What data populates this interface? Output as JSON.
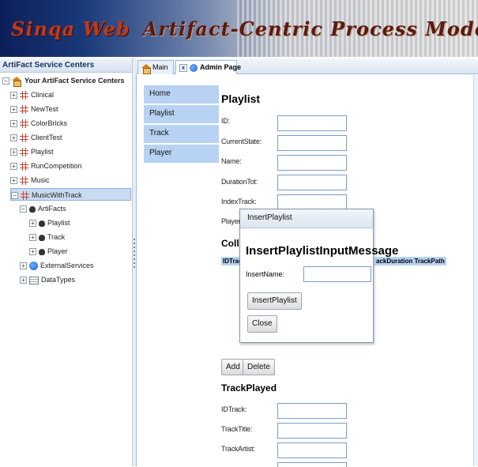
{
  "banner": {
    "title_left": "Sinqa Web",
    "title_right": "Artifact-Centric Process Modeling"
  },
  "sidebar": {
    "header": "ArtiFact Service Centers",
    "root": "Your ArtiFact Service Centers",
    "items": [
      "Clinical",
      "NewTest",
      "ColorBricks",
      "ClientTest",
      "Playlist",
      "RunCompetition",
      "Music",
      "MusicWithTrack"
    ],
    "artifacts": "ArtiFacts",
    "artifact_items": [
      "Playlist",
      "Track",
      "Player"
    ],
    "external": "ExternalServices",
    "datatypes": "DataTypes",
    "expand_plus": "+",
    "expand_minus": "−"
  },
  "tabs": {
    "main": "Main",
    "admin": "Admin Page",
    "close_x": "x"
  },
  "menu": [
    "Home",
    "Playlist",
    "Track",
    "Player"
  ],
  "playlist": {
    "title": "Playlist",
    "fields": [
      "ID:",
      "CurrentState:",
      "Name:",
      "DurationTot:",
      "IndexTrack:",
      "PlayerID"
    ],
    "collection_title": "Collec",
    "col_left": "IDTrack",
    "col_right": "ackDuration TrackPath",
    "add": "Add",
    "delete": "Delete"
  },
  "trackplayed": {
    "title": "TrackPlayed",
    "fields": [
      "IDTrack:",
      "TrackTitle:",
      "TrackArtist:"
    ]
  },
  "dialog": {
    "header": "InsertPlaylist",
    "title": "InsertPlaylistInputMessage",
    "field_label": "InsertName:",
    "insert_button": "InsertPlaylist",
    "close_button": "Close"
  }
}
